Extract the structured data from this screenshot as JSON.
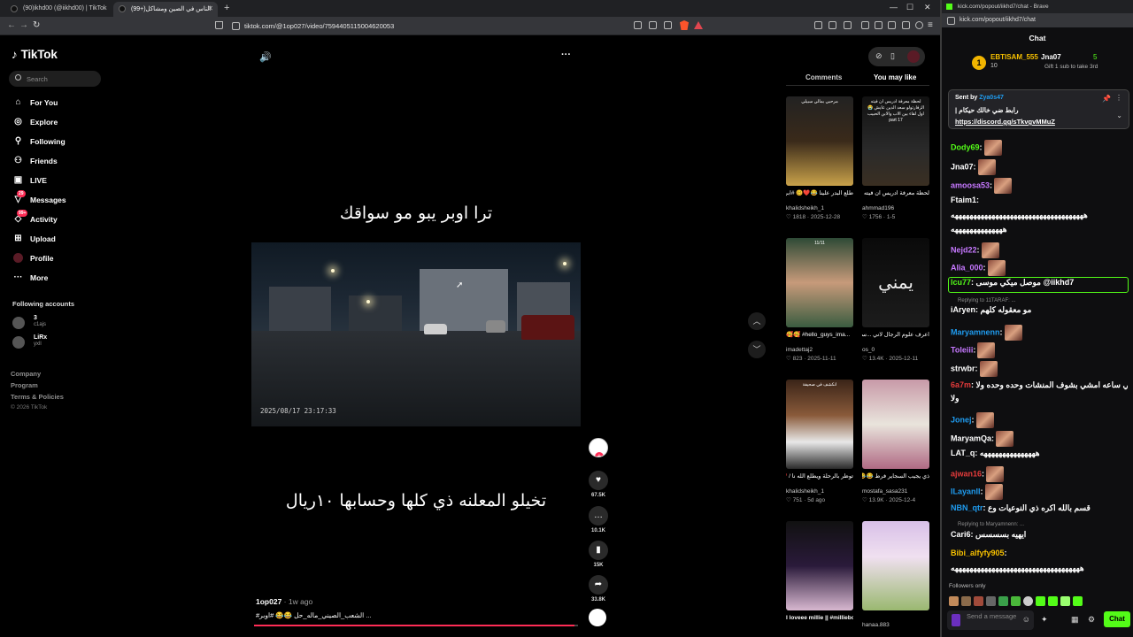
{
  "browser_left": {
    "tabs": [
      {
        "label": "(90)ikhd00 (@iikhd00) | TikTok"
      },
      {
        "label": "(99+)الناس في الصين ومشاكل"
      }
    ],
    "url": "tiktok.com/@1op027/video/7594405115004620053"
  },
  "tiktok": {
    "logo": "TikTok",
    "search_placeholder": "Search",
    "nav": [
      {
        "label": "For You",
        "icon": "home-icon"
      },
      {
        "label": "Explore",
        "icon": "compass-icon"
      },
      {
        "label": "Following",
        "icon": "following-icon"
      },
      {
        "label": "Friends",
        "icon": "friends-icon"
      },
      {
        "label": "LIVE",
        "icon": "live-icon"
      },
      {
        "label": "Messages",
        "icon": "messages-icon",
        "badge": "29"
      },
      {
        "label": "Activity",
        "icon": "activity-icon",
        "badge": "99+"
      },
      {
        "label": "Upload",
        "icon": "upload-icon"
      },
      {
        "label": "Profile",
        "icon": "profile-avatar"
      },
      {
        "label": "More",
        "icon": "more-icon"
      }
    ],
    "following_header": "Following accounts",
    "following": [
      {
        "name": "3",
        "handle": "c1ajs"
      },
      {
        "name": "LiRx",
        "handle": "yxll"
      }
    ],
    "footer": {
      "company": "Company",
      "program": "Program",
      "terms": "Terms & Policies",
      "copyright": "© 2026 TikTok"
    },
    "video": {
      "caption_top": "ترا اوبر يبو مو سواقك",
      "caption_bottom": "تخيلو المعلنه ذي كلها وحسابها ١٠ريال",
      "timestamp": "2025/08/17   23:17:33",
      "author": "1op027",
      "ago": "· 1w ago",
      "description": "#الشعب_الصيني_ماله_حل 😂😂 #اوبر ...",
      "progress": 0.99
    },
    "actions": {
      "likes": "67.5K",
      "comments": "10.1K",
      "saves": "15K",
      "shares": "33.8K"
    },
    "panel_tabs": [
      "Comments",
      "You may like"
    ],
    "cards": [
      {
        "title": "طلع البدر علينا 😂❤️🥴 #ابراهيم_الفرشي",
        "user": "khalidsheikh_1",
        "likes": "1818",
        "date": "2025-12-28",
        "thumb_text": "مرحبي بمالي سبيلي"
      },
      {
        "title": "لحظة معرفة ادريس ان فيته ...فارتولو سعد الدين عايش",
        "user": "ahmmad196",
        "likes": "1756",
        "date": "1-5",
        "thumb_text": "لحظة معرفة ادريس ان فيته الزفارتولو سعد الدين عايش 😭 اول لقاء بين الاب والابن الحبيب part 17"
      },
      {
        "title": "🥰🥰 #hello_guys_ima...",
        "user": "imadettaj2",
        "likes": "823",
        "date": "2025-11-11",
        "thumb_text": "11/11"
      },
      {
        "title": "اعرف علوم الرجال لاني ...ساي فيلي #القوات_العليا",
        "user": "os_0",
        "likes": "13.4K",
        "date": "2025-12-11",
        "thumb_text": "يمني"
      },
      {
        "title": "توظر بالرحلة ويطلع الله نا / ❤️😂",
        "user": "khalidsheikh_1",
        "likes": "751",
        "date": "5d ago",
        "thumb_text": "انكشف في صحيفة"
      },
      {
        "title": "ذي يجيب السجاير فرط 😂😂😂",
        "user": "mostafa_sasa231",
        "likes": "13.9K",
        "date": "2025-12-4",
        "thumb_text": ""
      },
      {
        "title": "I loveee millie || #milliebobbybro...",
        "user": "",
        "likes": "",
        "date": "",
        "thumb_text": ""
      },
      {
        "title": "",
        "user": "hanaa.883",
        "likes": "",
        "date": "",
        "thumb_text": ""
      }
    ]
  },
  "browser_right": {
    "title": "kick.com/popout/iikhd7/chat - Brave",
    "url": "kick.com/popout/iikhd7/chat"
  },
  "chat": {
    "header": "Chat",
    "gift": {
      "name": "EBTISAM_555",
      "count": "10",
      "gifter": "Jna07",
      "gifter_count": "5",
      "note": "Gift 1 sub to take 3rd"
    },
    "pinned": {
      "sent_by": "Sent by",
      "sender": "Zya0s47",
      "message": "رابط ضي خالك حيكام |",
      "link": "https://discord.gg/sTkvgvMMuZ"
    },
    "messages": [
      {
        "user": "Dody69",
        "text": ":",
        "color": "#53fc18",
        "emote": true
      },
      {
        "user": "Jna07",
        "text": ":",
        "color": "#ffffff",
        "emote": true
      },
      {
        "user": "amoosa53",
        "text": ":",
        "color": "#c678ff",
        "emote": true
      },
      {
        "user": "Ftaim1",
        "text": ":",
        "color": "#ffffff",
        "emote": false
      },
      {
        "user": "",
        "text": "ههههههههههههههههههههههههههههههههههههه",
        "color": "#ffffff",
        "emote": false
      },
      {
        "user": "",
        "text": "ههههههههههههههه",
        "color": "#ffffff",
        "emote": false
      },
      {
        "user": "Nejd22",
        "text": ":",
        "color": "#c678ff",
        "emote": true
      },
      {
        "user": "Alia_000",
        "text": ":",
        "color": "#c678ff",
        "emote": true
      },
      {
        "user": "lcu77",
        "text": ": موصل ميكي موسى @iikhd7",
        "color": "#53fc18",
        "emote": false
      },
      {
        "user": "iAryen",
        "text": ": مو معقوله كلهم",
        "color": "#ffffff",
        "emote": false
      },
      {
        "user": "Maryamnenn",
        "text": ":",
        "color": "#1f9cf0",
        "emote": true
      },
      {
        "user": "Toleiii",
        "text": ":",
        "color": "#c678ff",
        "emote": true
      },
      {
        "user": "strwbr",
        "text": ":",
        "color": "#ffffff",
        "emote": true
      },
      {
        "user": "6a7m",
        "text": ": لي ساعه امشي بشوف المنشات وحده وحده ولا",
        "color": "#e53b3b",
        "emote": false
      },
      {
        "user": "",
        "text": "ولا",
        "color": "#ffffff",
        "emote": false
      },
      {
        "user": "Jonej",
        "text": ":",
        "color": "#1f9cf0",
        "emote": true
      },
      {
        "user": "MaryamQa",
        "text": ":",
        "color": "#ffffff",
        "emote": true
      },
      {
        "user": "LAT_q",
        "text": ": هههههههههههههههه",
        "color": "#ffffff",
        "emote": false
      },
      {
        "user": "ajwan16",
        "text": ":",
        "color": "#e53b3b",
        "emote": true
      },
      {
        "user": "ILayanII",
        "text": ":",
        "color": "#1f9cf0",
        "emote": true
      },
      {
        "user": "NBN_qtr",
        "text": ": قسم بالله اكره ذي النوعيات وع",
        "color": "#1f9cf0",
        "emote": false
      },
      {
        "user": "Cari6",
        "text": ": ايهيه بسسسس",
        "color": "#ffffff",
        "emote": false
      },
      {
        "user": "Bibi_alfyfy905",
        "text": ":",
        "color": "#f6c000",
        "emote": false
      },
      {
        "user": "",
        "text": "هههههههههههههههههههههههههههههههههههه",
        "color": "#ffffff",
        "emote": false
      }
    ],
    "reply_notes": [
      "Replying to 11TARAF: ...",
      "Replying to Maryamnenn: ..."
    ],
    "followers_only": "Followers only",
    "input_placeholder": "Send a message",
    "send_label": "Chat"
  },
  "colors": {
    "tiktok_red": "#fe2c55",
    "kick_green": "#53fc18",
    "bg": "#000000"
  }
}
